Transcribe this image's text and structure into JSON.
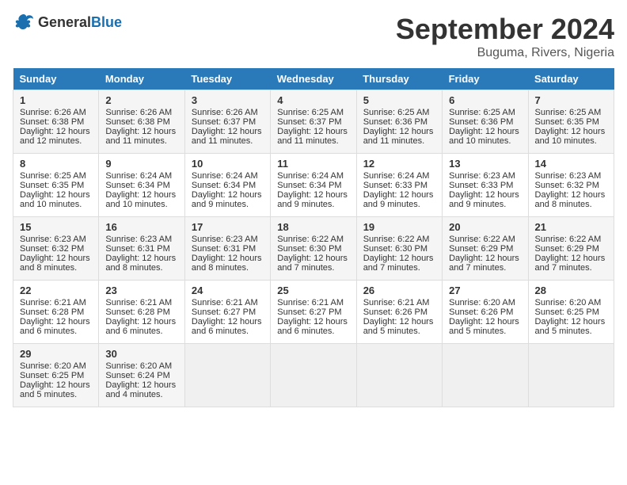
{
  "logo": {
    "general": "General",
    "blue": "Blue"
  },
  "title": "September 2024",
  "location": "Buguma, Rivers, Nigeria",
  "days_header": [
    "Sunday",
    "Monday",
    "Tuesday",
    "Wednesday",
    "Thursday",
    "Friday",
    "Saturday"
  ],
  "weeks": [
    [
      {
        "day": "1",
        "sunrise": "Sunrise: 6:26 AM",
        "sunset": "Sunset: 6:38 PM",
        "daylight": "Daylight: 12 hours and 12 minutes."
      },
      {
        "day": "2",
        "sunrise": "Sunrise: 6:26 AM",
        "sunset": "Sunset: 6:38 PM",
        "daylight": "Daylight: 12 hours and 11 minutes."
      },
      {
        "day": "3",
        "sunrise": "Sunrise: 6:26 AM",
        "sunset": "Sunset: 6:37 PM",
        "daylight": "Daylight: 12 hours and 11 minutes."
      },
      {
        "day": "4",
        "sunrise": "Sunrise: 6:25 AM",
        "sunset": "Sunset: 6:37 PM",
        "daylight": "Daylight: 12 hours and 11 minutes."
      },
      {
        "day": "5",
        "sunrise": "Sunrise: 6:25 AM",
        "sunset": "Sunset: 6:36 PM",
        "daylight": "Daylight: 12 hours and 11 minutes."
      },
      {
        "day": "6",
        "sunrise": "Sunrise: 6:25 AM",
        "sunset": "Sunset: 6:36 PM",
        "daylight": "Daylight: 12 hours and 10 minutes."
      },
      {
        "day": "7",
        "sunrise": "Sunrise: 6:25 AM",
        "sunset": "Sunset: 6:35 PM",
        "daylight": "Daylight: 12 hours and 10 minutes."
      }
    ],
    [
      {
        "day": "8",
        "sunrise": "Sunrise: 6:25 AM",
        "sunset": "Sunset: 6:35 PM",
        "daylight": "Daylight: 12 hours and 10 minutes."
      },
      {
        "day": "9",
        "sunrise": "Sunrise: 6:24 AM",
        "sunset": "Sunset: 6:34 PM",
        "daylight": "Daylight: 12 hours and 10 minutes."
      },
      {
        "day": "10",
        "sunrise": "Sunrise: 6:24 AM",
        "sunset": "Sunset: 6:34 PM",
        "daylight": "Daylight: 12 hours and 9 minutes."
      },
      {
        "day": "11",
        "sunrise": "Sunrise: 6:24 AM",
        "sunset": "Sunset: 6:34 PM",
        "daylight": "Daylight: 12 hours and 9 minutes."
      },
      {
        "day": "12",
        "sunrise": "Sunrise: 6:24 AM",
        "sunset": "Sunset: 6:33 PM",
        "daylight": "Daylight: 12 hours and 9 minutes."
      },
      {
        "day": "13",
        "sunrise": "Sunrise: 6:23 AM",
        "sunset": "Sunset: 6:33 PM",
        "daylight": "Daylight: 12 hours and 9 minutes."
      },
      {
        "day": "14",
        "sunrise": "Sunrise: 6:23 AM",
        "sunset": "Sunset: 6:32 PM",
        "daylight": "Daylight: 12 hours and 8 minutes."
      }
    ],
    [
      {
        "day": "15",
        "sunrise": "Sunrise: 6:23 AM",
        "sunset": "Sunset: 6:32 PM",
        "daylight": "Daylight: 12 hours and 8 minutes."
      },
      {
        "day": "16",
        "sunrise": "Sunrise: 6:23 AM",
        "sunset": "Sunset: 6:31 PM",
        "daylight": "Daylight: 12 hours and 8 minutes."
      },
      {
        "day": "17",
        "sunrise": "Sunrise: 6:23 AM",
        "sunset": "Sunset: 6:31 PM",
        "daylight": "Daylight: 12 hours and 8 minutes."
      },
      {
        "day": "18",
        "sunrise": "Sunrise: 6:22 AM",
        "sunset": "Sunset: 6:30 PM",
        "daylight": "Daylight: 12 hours and 7 minutes."
      },
      {
        "day": "19",
        "sunrise": "Sunrise: 6:22 AM",
        "sunset": "Sunset: 6:30 PM",
        "daylight": "Daylight: 12 hours and 7 minutes."
      },
      {
        "day": "20",
        "sunrise": "Sunrise: 6:22 AM",
        "sunset": "Sunset: 6:29 PM",
        "daylight": "Daylight: 12 hours and 7 minutes."
      },
      {
        "day": "21",
        "sunrise": "Sunrise: 6:22 AM",
        "sunset": "Sunset: 6:29 PM",
        "daylight": "Daylight: 12 hours and 7 minutes."
      }
    ],
    [
      {
        "day": "22",
        "sunrise": "Sunrise: 6:21 AM",
        "sunset": "Sunset: 6:28 PM",
        "daylight": "Daylight: 12 hours and 6 minutes."
      },
      {
        "day": "23",
        "sunrise": "Sunrise: 6:21 AM",
        "sunset": "Sunset: 6:28 PM",
        "daylight": "Daylight: 12 hours and 6 minutes."
      },
      {
        "day": "24",
        "sunrise": "Sunrise: 6:21 AM",
        "sunset": "Sunset: 6:27 PM",
        "daylight": "Daylight: 12 hours and 6 minutes."
      },
      {
        "day": "25",
        "sunrise": "Sunrise: 6:21 AM",
        "sunset": "Sunset: 6:27 PM",
        "daylight": "Daylight: 12 hours and 6 minutes."
      },
      {
        "day": "26",
        "sunrise": "Sunrise: 6:21 AM",
        "sunset": "Sunset: 6:26 PM",
        "daylight": "Daylight: 12 hours and 5 minutes."
      },
      {
        "day": "27",
        "sunrise": "Sunrise: 6:20 AM",
        "sunset": "Sunset: 6:26 PM",
        "daylight": "Daylight: 12 hours and 5 minutes."
      },
      {
        "day": "28",
        "sunrise": "Sunrise: 6:20 AM",
        "sunset": "Sunset: 6:25 PM",
        "daylight": "Daylight: 12 hours and 5 minutes."
      }
    ],
    [
      {
        "day": "29",
        "sunrise": "Sunrise: 6:20 AM",
        "sunset": "Sunset: 6:25 PM",
        "daylight": "Daylight: 12 hours and 5 minutes."
      },
      {
        "day": "30",
        "sunrise": "Sunrise: 6:20 AM",
        "sunset": "Sunset: 6:24 PM",
        "daylight": "Daylight: 12 hours and 4 minutes."
      },
      {
        "day": "",
        "sunrise": "",
        "sunset": "",
        "daylight": ""
      },
      {
        "day": "",
        "sunrise": "",
        "sunset": "",
        "daylight": ""
      },
      {
        "day": "",
        "sunrise": "",
        "sunset": "",
        "daylight": ""
      },
      {
        "day": "",
        "sunrise": "",
        "sunset": "",
        "daylight": ""
      },
      {
        "day": "",
        "sunrise": "",
        "sunset": "",
        "daylight": ""
      }
    ]
  ]
}
